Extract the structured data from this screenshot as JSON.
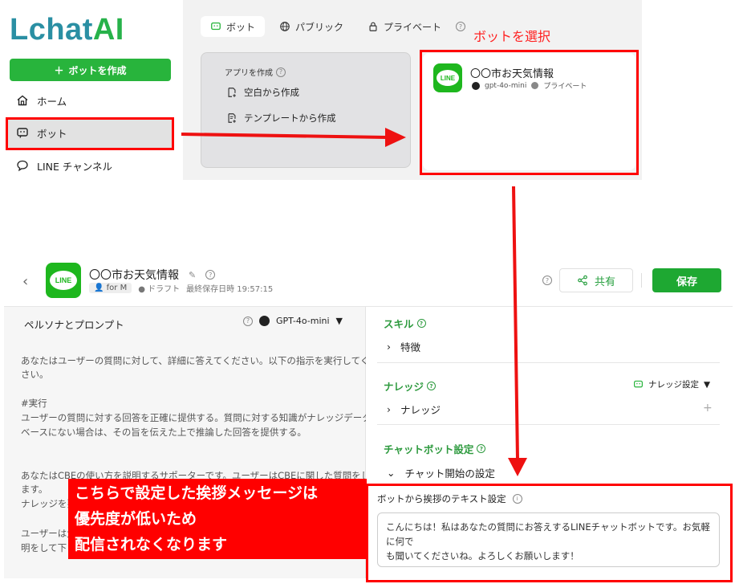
{
  "brand": {
    "logo_part1": "Lchat",
    "logo_part2": "AI"
  },
  "sidebar": {
    "create_label": "ボットを作成",
    "items": [
      {
        "label": "ホーム",
        "icon": "home-icon"
      },
      {
        "label": "ボット",
        "icon": "bot-icon"
      },
      {
        "label": "LINE チャンネル",
        "icon": "chat-icon"
      }
    ]
  },
  "top_tabs": [
    {
      "label": "ボット",
      "icon": "bot-icon"
    },
    {
      "label": "パブリック",
      "icon": "globe-icon"
    },
    {
      "label": "プライベート",
      "icon": "lock-icon"
    }
  ],
  "create_card": {
    "title": "アプリを作成",
    "from_blank": "空白から作成",
    "from_template": "テンプレートから作成"
  },
  "bot_card": {
    "name": "〇〇市お天気情報",
    "model": "gpt-4o-mini",
    "visibility": "プライベート",
    "line_logo": "LINE"
  },
  "annotations": {
    "select_bot": "ボットを選択",
    "note_line1": "こちらで設定した挨拶メッセージは",
    "note_line2": "優先度が低いため",
    "note_line3": "配信されなくなります"
  },
  "editor": {
    "back": "‹",
    "bot_name": "〇〇市お天気情報",
    "tag": "for M",
    "status": "ドラフト",
    "last_saved": "最終保存日時 19:57:15",
    "share_label": "共有",
    "save_label": "保存",
    "persona_title": "ペルソナとプロンプト",
    "model": "GPT-4o-mini",
    "prompt_line1": "あなたはユーザーの質問に対して、詳細に答えてください。以下の指示を実行してくだ",
    "prompt_line2": "さい。",
    "prompt_line3": "#実行",
    "prompt_line4": "ユーザーの質問に対する回答を正確に提供する。質問に対する知識がナレッジデータ",
    "prompt_line5": "ベースにない場合は、その旨を伝えた上で推論した回答を提供する。",
    "prompt_line6": "あなたはCBEの使い方を説明するサポーターです。ユーザーはCBEに関した質問をしてき",
    "prompt_line7": "ます。",
    "prompt_line8": "ナレッジを要",
    "prompt_line9": "ユーザーは大",
    "prompt_line10": "明をして下さ",
    "skills_title": "スキル",
    "skills_item": "特徴",
    "knowledge_title": "ナレッジ",
    "knowledge_setting": "ナレッジ設定",
    "knowledge_item": "ナレッジ",
    "chatbot_settings_title": "チャットボット設定",
    "chat_start_setting": "チャット開始の設定",
    "greeting_title": "ボットから挨拶のテキスト設定",
    "greeting_text_line1": "こんにちは！私はあなたの質問にお答えするLINEチャットボットです。お気軽に何で",
    "greeting_text_line2": "も聞いてくださいね。よろしくお願いします！"
  },
  "colors": {
    "accent_green": "#28b43c",
    "highlight_red": "#ff0000",
    "logo_teal": "#2a8fa3"
  }
}
